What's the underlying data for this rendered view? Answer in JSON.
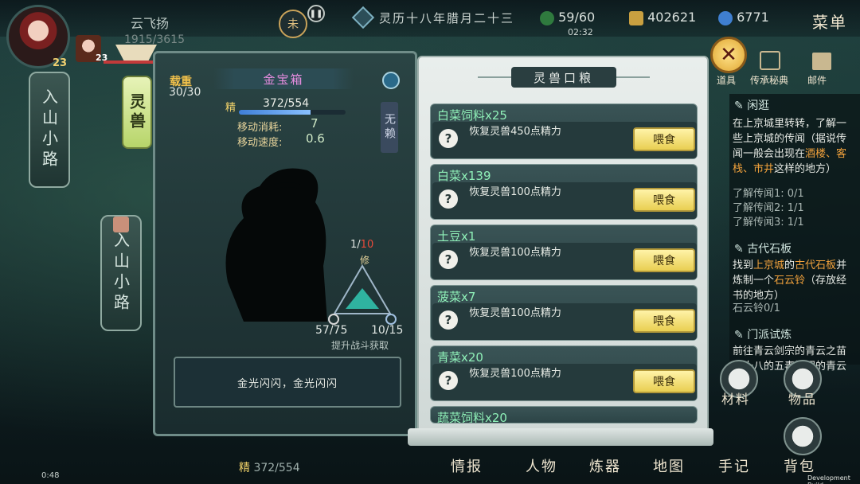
{
  "player": {
    "name": "云飞扬",
    "hp": "1915/3615",
    "level": "23",
    "pet_level": "23"
  },
  "topbar": {
    "date": "灵历十八年腊月二十三",
    "stamina": "59/60",
    "stamina_timer": "02:32",
    "coins": "402621",
    "spirit": "6771",
    "menu": "菜单",
    "clock_glyph": "未"
  },
  "left_nav": {
    "scroll1": "入山小路",
    "scroll2": "入山小路",
    "tag": "灵兽"
  },
  "pet": {
    "load_label": "载重",
    "load_value": "30/30",
    "name": "金宝箱",
    "jing_label": "精",
    "jing_value": "372/554",
    "jing_fraction": 0.67,
    "move_cost_label": "移动消耗:",
    "move_cost": "7",
    "move_speed_label": "移动速度:",
    "move_speed": "0.6",
    "side_tag": "无赖",
    "cultivate_value": "1",
    "cultivate_max": "10",
    "cultivate_label": "修",
    "stat_left": "57/75",
    "stat_right": "10/15",
    "upgrade_hint": "提升战斗获取",
    "description": "金光闪闪，金光闪闪",
    "bottom_jing_label": "精",
    "bottom_jing_value": "372/554"
  },
  "food_panel": {
    "title": "灵兽口粮",
    "items": [
      {
        "name": "白菜饲料x25",
        "desc": "恢复灵兽450点精力",
        "button": "喂食"
      },
      {
        "name": "白菜x139",
        "desc": "恢复灵兽100点精力",
        "button": "喂食"
      },
      {
        "name": "土豆x1",
        "desc": "恢复灵兽100点精力",
        "button": "喂食"
      },
      {
        "name": "菠菜x7",
        "desc": "恢复灵兽100点精力",
        "button": "喂食"
      },
      {
        "name": "青菜x20",
        "desc": "恢复灵兽100点精力",
        "button": "喂食"
      },
      {
        "name": "蔬菜饲料x20"
      }
    ]
  },
  "quests": {
    "q1_title": "闲逛",
    "q1_text1": "在上京城里转转，了解一些上京城的传闻（据说传闻一般会出现在",
    "q1_hl": "酒楼、客栈、市井",
    "q1_text2": "这样的地方）",
    "q1_p1": "了解传闻1: 0/1",
    "q1_p2": "了解传闻2: 1/1",
    "q1_p3": "了解传闻3: 1/1",
    "q2_title": "古代石板",
    "q2_text1": "找到",
    "q2_hl1": "上京城",
    "q2_text2": "的",
    "q2_hl2": "古代石板",
    "q2_text3": "并炼制一个",
    "q2_hl3": "石云铃",
    "q2_text4": "（存放经书的地方）",
    "q2_p1": "石云铃0/1",
    "q3_title": "门派试炼",
    "q3_text": "前往青云剑宗的青云之苗疆十八的五毒解门的青云存在岳径"
  },
  "top_right": {
    "btn1": "道具",
    "btn2": "传承秘典",
    "btn3": "邮件"
  },
  "bottom_nav": {
    "n1": "情报",
    "n2": "人物",
    "n3": "炼器",
    "n4": "地图",
    "n5": "手记",
    "n6": "背包",
    "side1": "材料",
    "side2": "物品"
  },
  "status": {
    "time": "0:48",
    "build": "Development Build"
  }
}
